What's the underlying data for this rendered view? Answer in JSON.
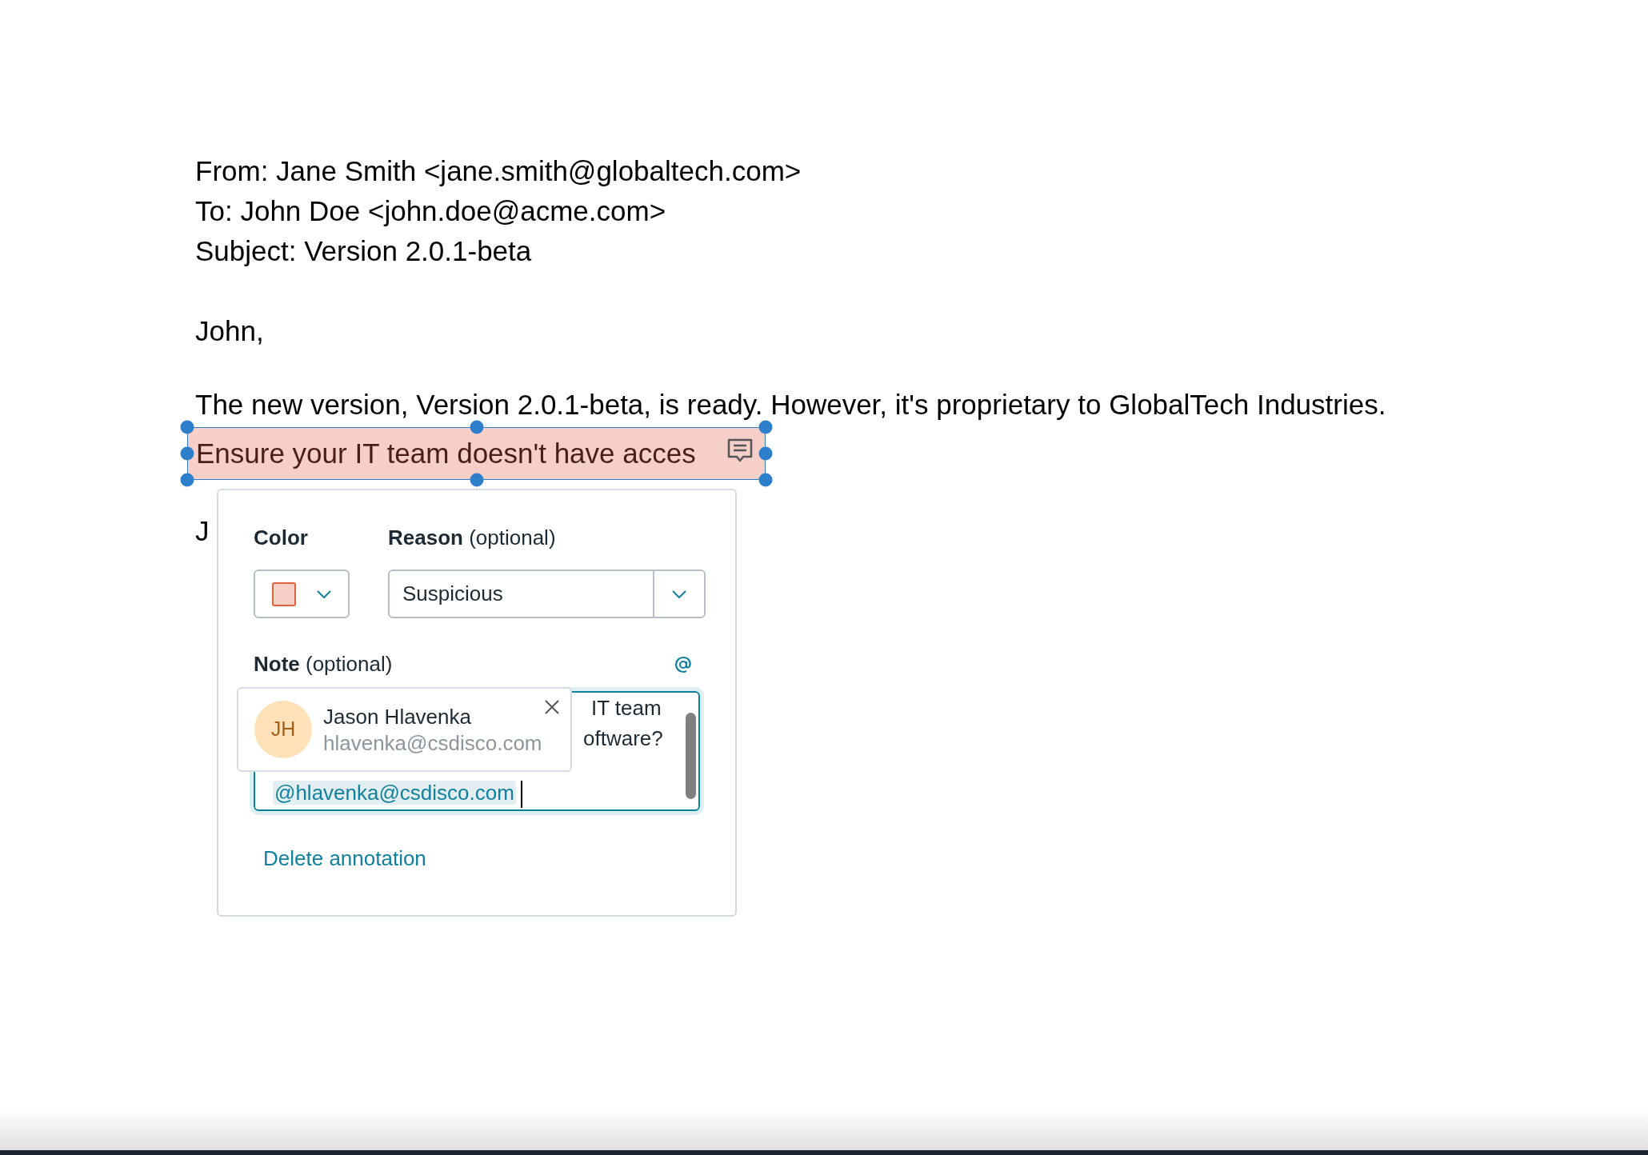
{
  "email": {
    "header_lines": [
      "From: Jane Smith <jane.smith@globaltech.com>",
      "To: John Doe <john.doe@acme.com>",
      "Subject: Version 2.0.1-beta"
    ],
    "greeting": "John,",
    "body_line": "The new version, Version 2.0.1-beta, is ready. However, it's proprietary to GlobalTech Industries.",
    "highlighted_text": "Ensure your IT team doesn't have acces",
    "signature_fragment": "J"
  },
  "annotation": {
    "selected": true,
    "color": "#f5cfc8",
    "color_label": "Color",
    "reason_label": "**Reason** (optional)",
    "reason_value": "Suspicious",
    "note_label": "**Note** (optional)",
    "note_lines": [
      "IT team",
      "oftware?"
    ],
    "mention": "@hlavenka@csdisco.com",
    "delete_label": "Delete annotation"
  },
  "mention_suggestion": {
    "initials": "JH",
    "name": "Jason Hlavenka",
    "email": "hlavenka@csdisco.com"
  }
}
